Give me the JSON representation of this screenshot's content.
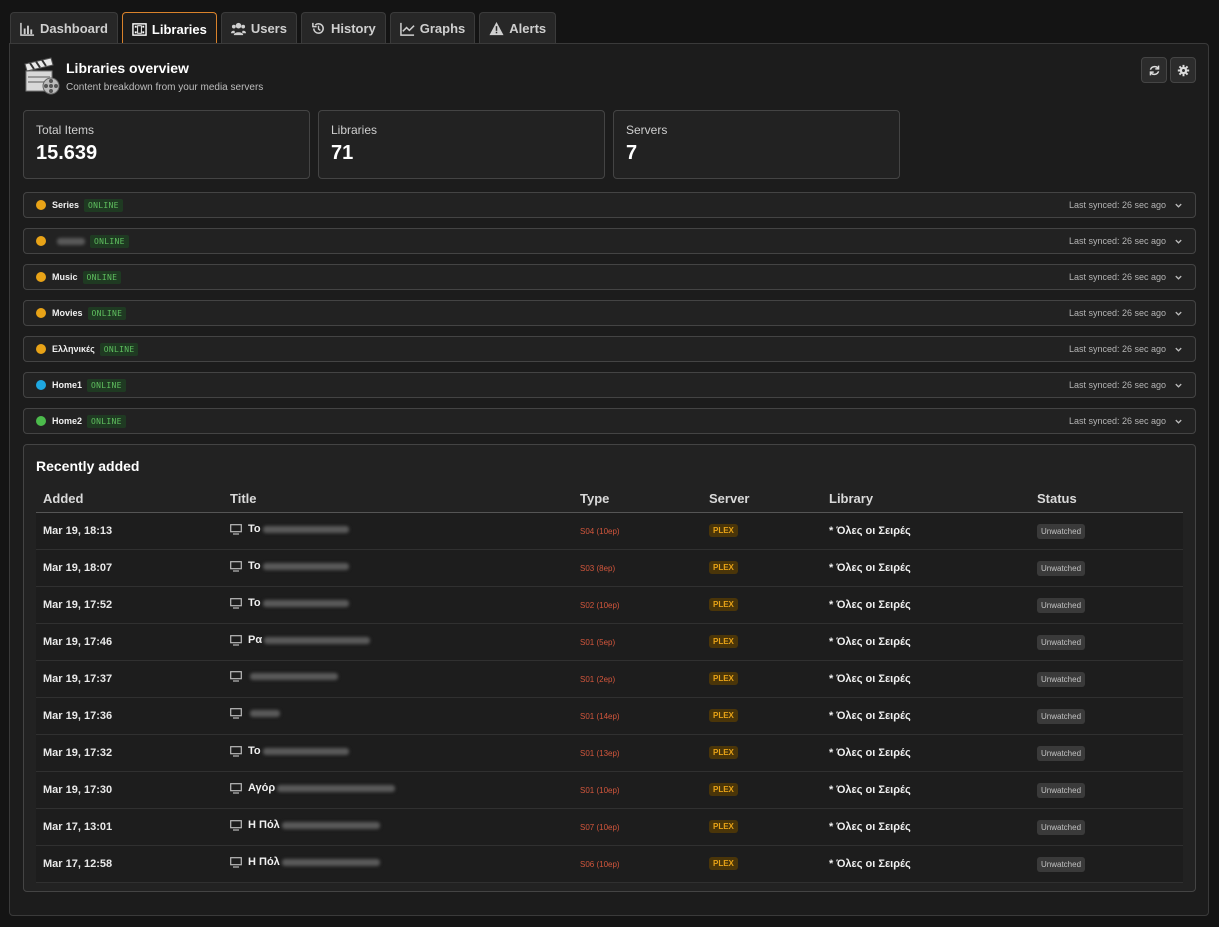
{
  "tabs": [
    {
      "label": "Dashboard",
      "icon": "bar-chart-icon"
    },
    {
      "label": "Libraries",
      "icon": "film-icon",
      "active": true
    },
    {
      "label": "Users",
      "icon": "users-icon"
    },
    {
      "label": "History",
      "icon": "history-icon"
    },
    {
      "label": "Graphs",
      "icon": "line-chart-icon"
    },
    {
      "label": "Alerts",
      "icon": "alert-icon"
    }
  ],
  "header": {
    "title": "Libraries overview",
    "subtitle": "Content breakdown from your media servers"
  },
  "stats": [
    {
      "label": "Total Items",
      "value": "15.639"
    },
    {
      "label": "Libraries",
      "value": "71"
    },
    {
      "label": "Servers",
      "value": "7"
    }
  ],
  "libraries": [
    {
      "name": "Series",
      "status": "ONLINE",
      "synced": "Last synced: 26 sec ago",
      "color": "#e8a317"
    },
    {
      "name": "",
      "status": "ONLINE",
      "synced": "Last synced: 26 sec ago",
      "color": "#e8a317"
    },
    {
      "name": "Music",
      "status": "ONLINE",
      "synced": "Last synced: 26 sec ago",
      "color": "#e8a317"
    },
    {
      "name": "Movies",
      "status": "ONLINE",
      "synced": "Last synced: 26 sec ago",
      "color": "#e8a317"
    },
    {
      "name": "Ελληνικές",
      "status": "ONLINE",
      "synced": "Last synced: 26 sec ago",
      "color": "#e8a317"
    },
    {
      "name": "Home1",
      "status": "ONLINE",
      "synced": "Last synced: 26 sec ago",
      "color": "#1ea7e0"
    },
    {
      "name": "Home2",
      "status": "ONLINE",
      "synced": "Last synced: 26 sec ago",
      "color": "#4cbb4c"
    }
  ],
  "recent": {
    "title": "Recently added",
    "columns": [
      "Added",
      "Title",
      "Type",
      "Server",
      "Library",
      "Status"
    ],
    "rows": [
      {
        "added": "Mar 19, 18:13",
        "title": "Το",
        "type": "S04 (10ep)",
        "server": "PLEX",
        "library": "* Όλες οι Σειρές",
        "status": "Unwatched"
      },
      {
        "added": "Mar 19, 18:07",
        "title": "Το",
        "type": "S03 (8ep)",
        "server": "PLEX",
        "library": "* Όλες οι Σειρές",
        "status": "Unwatched"
      },
      {
        "added": "Mar 19, 17:52",
        "title": "Το",
        "type": "S02 (10ep)",
        "server": "PLEX",
        "library": "* Όλες οι Σειρές",
        "status": "Unwatched"
      },
      {
        "added": "Mar 19, 17:46",
        "title": "Ρα",
        "type": "S01 (5ep)",
        "server": "PLEX",
        "library": "* Όλες οι Σειρές",
        "status": "Unwatched"
      },
      {
        "added": "Mar 19, 17:37",
        "title": "",
        "type": "S01 (2ep)",
        "server": "PLEX",
        "library": "* Όλες οι Σειρές",
        "status": "Unwatched"
      },
      {
        "added": "Mar 19, 17:36",
        "title": "",
        "type": "S01 (14ep)",
        "server": "PLEX",
        "library": "* Όλες οι Σειρές",
        "status": "Unwatched"
      },
      {
        "added": "Mar 19, 17:32",
        "title": "Το",
        "type": "S01 (13ep)",
        "server": "PLEX",
        "library": "* Όλες οι Σειρές",
        "status": "Unwatched"
      },
      {
        "added": "Mar 19, 17:30",
        "title": "Αγόρ",
        "type": "S01 (10ep)",
        "server": "PLEX",
        "library": "* Όλες οι Σειρές",
        "status": "Unwatched"
      },
      {
        "added": "Mar 17, 13:01",
        "title": "Η Πόλ",
        "type": "S07 (10ep)",
        "server": "PLEX",
        "library": "* Όλες οι Σειρές",
        "status": "Unwatched"
      },
      {
        "added": "Mar 17, 12:58",
        "title": "Η Πόλ",
        "type": "S06 (10ep)",
        "server": "PLEX",
        "library": "* Όλες οι Σειρές",
        "status": "Unwatched"
      }
    ]
  }
}
